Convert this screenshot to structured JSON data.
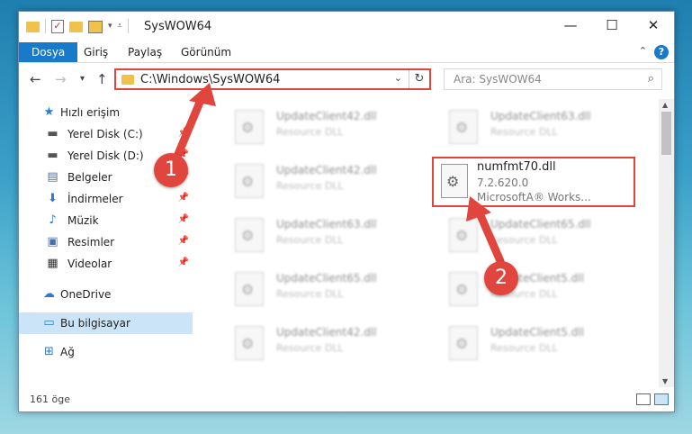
{
  "window": {
    "title": "SysWOW64",
    "minimize": "—",
    "maximize": "☐",
    "close": "✕"
  },
  "ribbon": {
    "tabs": [
      "Dosya",
      "Giriş",
      "Paylaş",
      "Görünüm"
    ],
    "help": "?"
  },
  "nav": {
    "address": "C:\\Windows\\SysWOW64",
    "search_placeholder": "Ara: SysWOW64"
  },
  "sidebar": {
    "items": [
      {
        "label": "Hızlı erişim",
        "icon": "star-icon"
      },
      {
        "label": "Yerel Disk (C:)",
        "icon": "drive-icon"
      },
      {
        "label": "Yerel Disk (D:)",
        "icon": "drive-icon"
      },
      {
        "label": "Belgeler",
        "icon": "documents-icon"
      },
      {
        "label": "İndirmeler",
        "icon": "download-icon"
      },
      {
        "label": "Müzik",
        "icon": "music-icon"
      },
      {
        "label": "Resimler",
        "icon": "pictures-icon"
      },
      {
        "label": "Videolar",
        "icon": "video-icon"
      },
      {
        "label": "OneDrive",
        "icon": "cloud-icon"
      },
      {
        "label": "Bu bilgisayar",
        "icon": "computer-icon"
      },
      {
        "label": "Ağ",
        "icon": "network-icon"
      }
    ]
  },
  "files": [
    {
      "name": "UpdateClient42.dll",
      "type": "Resource DLL"
    },
    {
      "name": "UpdateClient63.dll",
      "type": "Resource DLL"
    },
    {
      "name": "UpdateClient42.dll",
      "type": "Resource DLL"
    },
    {
      "name": "UpdateClient63.dll",
      "type": "Resource DLL"
    },
    {
      "name": "UpdateClient65.dll",
      "type": "Resource DLL"
    },
    {
      "name": "UpdateClient65.dll",
      "type": "Resource DLL"
    },
    {
      "name": "UpdateClient5.dll",
      "type": "Resource DLL"
    },
    {
      "name": "UpdateClient42.dll",
      "type": "Resource DLL"
    },
    {
      "name": "UpdateClient5.dll",
      "type": "Resource DLL"
    }
  ],
  "highlighted_file": {
    "name": "numfmt70.dll",
    "version": "7.2.620.0",
    "company": "MicrosoftA® Works..."
  },
  "status": {
    "count": "161 öge"
  },
  "annotations": {
    "step1": "1",
    "step2": "2"
  },
  "colors": {
    "accent": "#1979ca",
    "highlight": "#e0463d"
  }
}
